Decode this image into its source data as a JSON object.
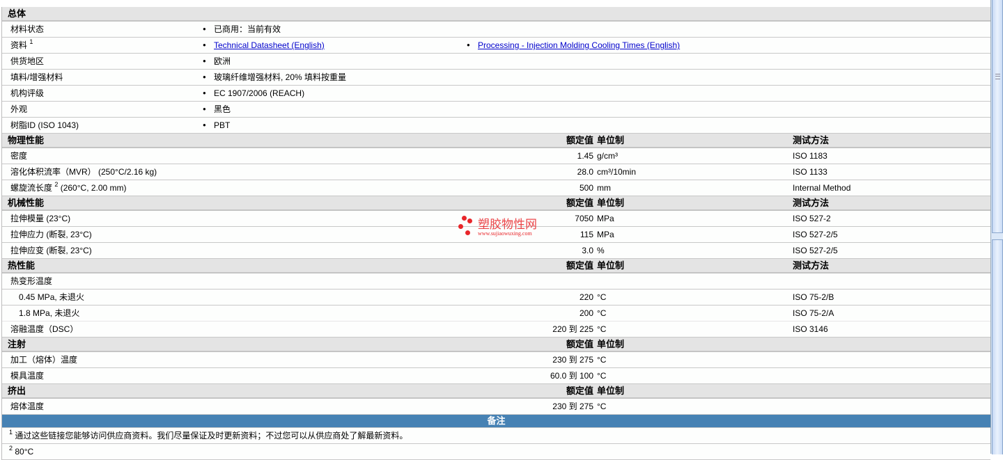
{
  "sections": [
    {
      "title": "总体",
      "type": "general",
      "rows": [
        {
          "label": "材料状态",
          "items": [
            "已商用：当前有效"
          ]
        },
        {
          "label": "资料",
          "sup": "1",
          "links": [
            "Technical Datasheet (English)",
            "Processing - Injection Molding Cooling Times (English)"
          ]
        },
        {
          "label": "供货地区",
          "items": [
            "欧洲"
          ]
        },
        {
          "label": "填料/增强材料",
          "items": [
            "玻璃纤维增强材料, 20% 填料按重量"
          ]
        },
        {
          "label": "机构评级",
          "items": [
            "EC 1907/2006 (REACH)"
          ]
        },
        {
          "label": "外观",
          "items": [
            "黑色"
          ]
        },
        {
          "label": "树脂ID (ISO 1043)",
          "items": [
            "PBT"
          ]
        }
      ]
    },
    {
      "title": "物理性能",
      "value_header": "额定值",
      "unit_header": "单位制",
      "method_header": "测试方法",
      "rows": [
        {
          "label": "密度",
          "value": "1.45",
          "unit": "g/cm³",
          "method": "ISO 1183"
        },
        {
          "label": "溶化体积流率（MVR） (250°C/2.16 kg)",
          "value": "28.0",
          "unit": "cm³/10min",
          "method": "ISO 1133"
        },
        {
          "label": "螺旋流长度",
          "sup": "2",
          "label_suffix": " (260°C, 2.00 mm)",
          "value": "500",
          "unit": "mm",
          "method": "Internal Method"
        }
      ]
    },
    {
      "title": "机械性能",
      "value_header": "额定值",
      "unit_header": "单位制",
      "method_header": "测试方法",
      "rows": [
        {
          "label": "拉伸模量 (23°C)",
          "value": "7050",
          "unit": "MPa",
          "method": "ISO 527-2"
        },
        {
          "label": "拉伸应力 (断裂, 23°C)",
          "value": "115",
          "unit": "MPa",
          "method": "ISO 527-2/5"
        },
        {
          "label": "拉伸应变 (断裂, 23°C)",
          "value": "3.0",
          "unit": "%",
          "method": "ISO 527-2/5"
        }
      ]
    },
    {
      "title": "热性能",
      "value_header": "额定值",
      "unit_header": "单位制",
      "method_header": "测试方法",
      "rows": [
        {
          "label": "热变形温度",
          "group": true
        },
        {
          "label": "0.45 MPa, 未退火",
          "indent": true,
          "value": "220",
          "unit": "°C",
          "method": "ISO 75-2/B"
        },
        {
          "label": "1.8 MPa, 未退火",
          "indent": true,
          "value": "200",
          "unit": "°C",
          "method": "ISO 75-2/A"
        },
        {
          "label": "溶融温度（DSC）",
          "value": "220 到  225",
          "unit": "°C",
          "method": "ISO 3146"
        }
      ]
    },
    {
      "title": "注射",
      "value_header": "额定值",
      "unit_header": "单位制",
      "rows": [
        {
          "label": "加工（熔体）温度",
          "value": "230 到  275",
          "unit": "°C"
        },
        {
          "label": "模具温度",
          "value": "60.0 到  100",
          "unit": "°C"
        }
      ]
    },
    {
      "title": "挤出",
      "value_header": "额定值",
      "unit_header": "单位制",
      "rows": [
        {
          "label": "熔体温度",
          "value": "230 到  275",
          "unit": "°C"
        }
      ]
    }
  ],
  "notes": {
    "title": "备注",
    "items": [
      {
        "sup": "1",
        "text": "通过这些链接您能够访问供应商资料。我们尽量保证及时更新资料；不过您可以从供应商处了解最新资料。"
      },
      {
        "sup": "2",
        "text": "80°C"
      }
    ]
  },
  "watermark": {
    "name": "塑胶物性网",
    "url": "www.sujiaowuxing.com"
  },
  "colors": {
    "header_bg": "#e4e4e4",
    "notes_bg": "#4682b4",
    "link": "#0000cc"
  }
}
